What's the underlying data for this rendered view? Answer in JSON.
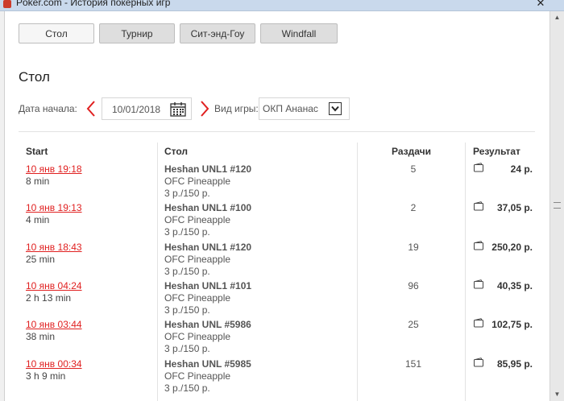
{
  "window": {
    "title": "Poker.com - История покерных игр",
    "close": "✕"
  },
  "tabs": [
    {
      "label": "Стол",
      "active": true
    },
    {
      "label": "Турнир",
      "active": false
    },
    {
      "label": "Сит-энд-Гоу",
      "active": false
    },
    {
      "label": "Windfall",
      "active": false
    }
  ],
  "section_title": "Стол",
  "filters": {
    "start_label": "Дата начала:",
    "date_value": "10/01/2018",
    "game_label": "Вид игры:",
    "game_value": "ОКП Ананас"
  },
  "columns": {
    "start": "Start",
    "table": "Стол",
    "hands": "Раздачи",
    "result": "Результат"
  },
  "rows": [
    {
      "start": "10 янв 19:18",
      "duration": "8 min",
      "table": "Heshan UNL1 #120",
      "game": "OFC Pineapple",
      "stakes": "3 р./150 р.",
      "hands": "5",
      "result": "24 р."
    },
    {
      "start": "10 янв 19:13",
      "duration": "4 min",
      "table": "Heshan UNL1 #100",
      "game": "OFC Pineapple",
      "stakes": "3 р./150 р.",
      "hands": "2",
      "result": "37,05 р."
    },
    {
      "start": "10 янв 18:43",
      "duration": "25 min",
      "table": "Heshan UNL1 #120",
      "game": "OFC Pineapple",
      "stakes": "3 р./150 р.",
      "hands": "19",
      "result": "250,20 р."
    },
    {
      "start": "10 янв 04:24",
      "duration": "2 h 13 min",
      "table": "Heshan UNL1 #101",
      "game": "OFC Pineapple",
      "stakes": "3 р./150 р.",
      "hands": "96",
      "result": "40,35 р."
    },
    {
      "start": "10 янв 03:44",
      "duration": "38 min",
      "table": "Heshan UNL #5986",
      "game": "OFC Pineapple",
      "stakes": "3 р./150 р.",
      "hands": "25",
      "result": "102,75 р."
    },
    {
      "start": "10 янв 00:34",
      "duration": "3 h 9 min",
      "table": "Heshan UNL #5985",
      "game": "OFC Pineapple",
      "stakes": "3 р./150 р.",
      "hands": "151",
      "result": "85,95 р."
    }
  ],
  "icons": {
    "prev": "chevron-left-icon",
    "next": "chevron-right-icon",
    "calendar": "calendar-icon",
    "dropdown": "chevron-down-icon",
    "result": "wallet-icon"
  },
  "colors": {
    "accent": "#e02020",
    "tab_bg": "#dedede",
    "tab_active_bg": "#f6f6f6"
  }
}
